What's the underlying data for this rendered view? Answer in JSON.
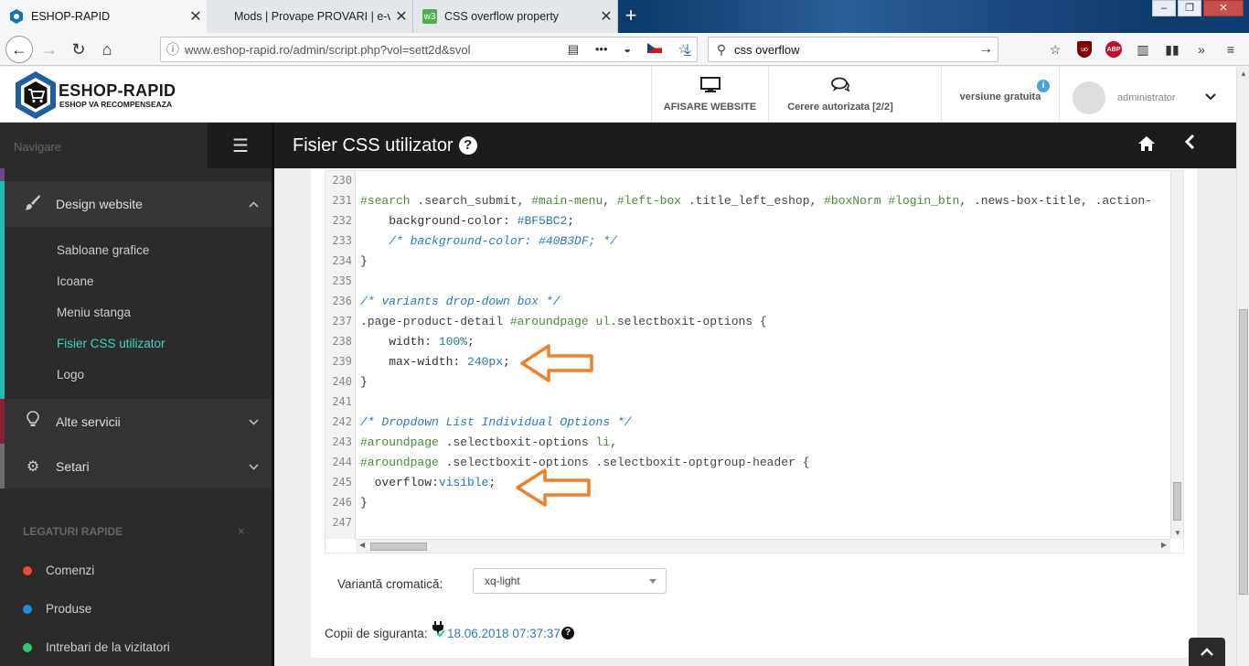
{
  "browser": {
    "tabs": [
      {
        "title": "ESHOP-RAPID",
        "close": "✕"
      },
      {
        "title": "Mods | Provape PROVARI | e-va",
        "close": "✕"
      },
      {
        "title": "CSS overflow property",
        "close": "✕",
        "favicon": "w3"
      }
    ],
    "new_tab": "+",
    "url": "www.eshop-rapid.ro/admin/script.php?vol=sett2d&svol",
    "search": "css overflow",
    "abp_label": "ABP",
    "ubo_label": "uo"
  },
  "header": {
    "logo_title": "ESHOP-RAPID",
    "logo_subtitle": "ESHOP VA RECOMPENSEAZA",
    "website_label": "AFISARE WEBSITE",
    "requests_label": "Cerere autorizata [2/2]",
    "version_label": "versiune gratuita",
    "version_info": "i",
    "username": "administrator"
  },
  "sidebar": {
    "nav_label": "Navigare",
    "design_section": "Design website",
    "sub_items": [
      {
        "label": "Sabloane grafice",
        "active": false
      },
      {
        "label": "Icoane",
        "active": false
      },
      {
        "label": "Meniu stanga",
        "active": false
      },
      {
        "label": "Fisier CSS utilizator",
        "active": true
      },
      {
        "label": "Logo",
        "active": false
      }
    ],
    "alte_section": "Alte servicii",
    "setari_section": "Setari",
    "quick_title": "LEGATURI RAPIDE",
    "quick_close": "×",
    "quick_links": [
      {
        "label": "Comenzi",
        "color": "#e74c3c"
      },
      {
        "label": "Produse",
        "color": "#1a8ed9"
      },
      {
        "label": "Intrebari de la vizitatori",
        "color": "#2ecc71"
      }
    ]
  },
  "page": {
    "title": "Fisier CSS utilizator",
    "help": "?"
  },
  "editor": {
    "line_numbers": [
      "230",
      "231",
      "232",
      "233",
      "234",
      "235",
      "236",
      "237",
      "238",
      "239",
      "240",
      "241",
      "242",
      "243",
      "244",
      "245",
      "246",
      "247"
    ],
    "lines": [
      [],
      [
        {
          "t": "#search",
          "c": "sel"
        },
        {
          "t": " .search_submit, ",
          "c": "cls"
        },
        {
          "t": "#main-menu",
          "c": "sel"
        },
        {
          "t": ", ",
          "c": "cls"
        },
        {
          "t": "#left-box",
          "c": "sel"
        },
        {
          "t": " .title_left_eshop, ",
          "c": "cls"
        },
        {
          "t": "#boxNorm",
          "c": "sel"
        },
        {
          "t": " ",
          "c": "cls"
        },
        {
          "t": "#login_btn",
          "c": "sel"
        },
        {
          "t": ", .news-box-title, .action-",
          "c": "cls"
        }
      ],
      [
        {
          "t": "    background-color: ",
          "c": "prop"
        },
        {
          "t": "#BF5BC2",
          "c": "val"
        },
        {
          "t": ";",
          "c": "prop"
        }
      ],
      [
        {
          "t": "    /* background-color: #40B3DF; */",
          "c": "cmt"
        }
      ],
      [
        {
          "t": "}",
          "c": "prop"
        }
      ],
      [],
      [
        {
          "t": "/* variants drop-down box */",
          "c": "cmt"
        }
      ],
      [
        {
          "t": ".page-product-detail ",
          "c": "cls"
        },
        {
          "t": "#aroundpage",
          "c": "sel"
        },
        {
          "t": " ",
          "c": "cls"
        },
        {
          "t": "ul",
          "c": "sel"
        },
        {
          "t": ".selectboxit-options {",
          "c": "cls"
        }
      ],
      [
        {
          "t": "    width: ",
          "c": "prop"
        },
        {
          "t": "100%",
          "c": "val"
        },
        {
          "t": ";",
          "c": "prop"
        }
      ],
      [
        {
          "t": "    max-width: ",
          "c": "prop"
        },
        {
          "t": "240px",
          "c": "val"
        },
        {
          "t": ";",
          "c": "prop"
        }
      ],
      [
        {
          "t": "}",
          "c": "prop"
        }
      ],
      [],
      [
        {
          "t": "/* Dropdown List Individual Options */",
          "c": "cmt"
        }
      ],
      [
        {
          "t": "#aroundpage",
          "c": "sel"
        },
        {
          "t": " .selectboxit-options ",
          "c": "cls"
        },
        {
          "t": "li",
          "c": "sel"
        },
        {
          "t": ",",
          "c": "cls"
        }
      ],
      [
        {
          "t": "#aroundpage",
          "c": "sel"
        },
        {
          "t": " .selectboxit-options .selectboxit-optgroup-header {",
          "c": "cls"
        }
      ],
      [
        {
          "t": "  overflow:",
          "c": "prop"
        },
        {
          "t": "visible",
          "c": "val"
        },
        {
          "t": ";",
          "c": "prop"
        }
      ],
      [
        {
          "t": "}",
          "c": "prop"
        }
      ],
      []
    ],
    "annotation_color": "#f07f2c"
  },
  "form": {
    "scheme_label": "Variantă cromatică:",
    "scheme_value": "xq-light",
    "backup_label": "Copii de siguranta:",
    "backup_date": "18.06.2018 07:37:37",
    "backup_help": "?"
  },
  "icons": {
    "monitor": "monitor-icon",
    "chat": "chat-icon",
    "home": "home-icon",
    "back": "chevron-left-icon",
    "brush": "brush-icon",
    "bulb": "lightbulb-icon",
    "gears": "gears-icon",
    "plug": "plug-icon",
    "totop": "chevron-up-icon"
  }
}
